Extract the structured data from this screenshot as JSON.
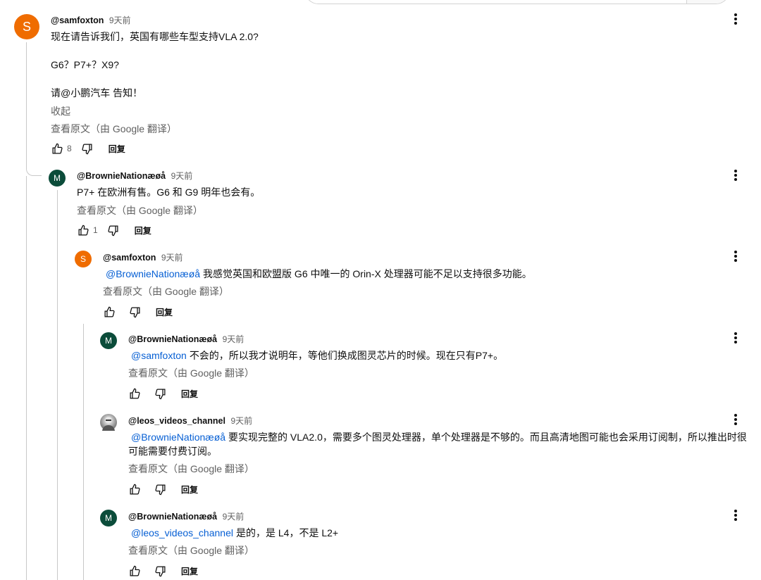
{
  "comments": [
    {
      "author": "@samfoxton",
      "time": "9天前",
      "avatar_letter": "S",
      "lines": [
        "现在请告诉我们，英国有哪些车型支持VLA 2.0?",
        "G6？P7+？X9?",
        "请@小鹏汽车 告知！"
      ],
      "collapse": "收起",
      "see_original": "查看原文（由 Google 翻译）",
      "likes": "8",
      "reply": "回复"
    },
    {
      "author": "@BrownieNationæøå",
      "time": "9天前",
      "avatar_letter": "M",
      "text": "P7+ 在欧洲有售。G6 和 G9 明年也会有。",
      "see_original": "查看原文（由 Google 翻译）",
      "likes": "1",
      "reply": "回复"
    },
    {
      "author": "@samfoxton",
      "time": "9天前",
      "avatar_letter": "S",
      "mention": "@BrownieNationæøå",
      "text": "我感觉英国和欧盟版 G6 中唯一的 Orin-X 处理器可能不足以支持很多功能。",
      "see_original": "查看原文（由 Google 翻译）",
      "reply": "回复"
    },
    {
      "author": "@BrownieNationæøå",
      "time": "9天前",
      "avatar_letter": "M",
      "mention": "@samfoxton",
      "text": "不会的，所以我才说明年，等他们换成图灵芯片的时候。现在只有P7+。",
      "see_original": "查看原文（由 Google 翻译）",
      "reply": "回复"
    },
    {
      "author": "@leos_videos_channel",
      "time": "9天前",
      "mention": "@BrownieNationæøå",
      "text": "要实现完整的 VLA2.0，需要多个图灵处理器，单个处理器是不够的。而且高清地图可能也会采用订阅制，所以推出时很可能需要付费订阅。",
      "see_original": "查看原文（由 Google 翻译）",
      "reply": "回复"
    },
    {
      "author": "@BrownieNationæøå",
      "time": "9天前",
      "avatar_letter": "M",
      "mention": "@leos_videos_channel",
      "text": "是的，是 L4，不是 L2+",
      "see_original": "查看原文（由 Google 翻译）",
      "reply": "回复"
    }
  ],
  "colors": {
    "link": "#065fd4",
    "orange_avatar": "#ef6c00",
    "green_avatar": "#0b4c3a"
  },
  "icons": [
    "thumb-up-icon",
    "thumb-down-icon",
    "more-vert-icon"
  ]
}
